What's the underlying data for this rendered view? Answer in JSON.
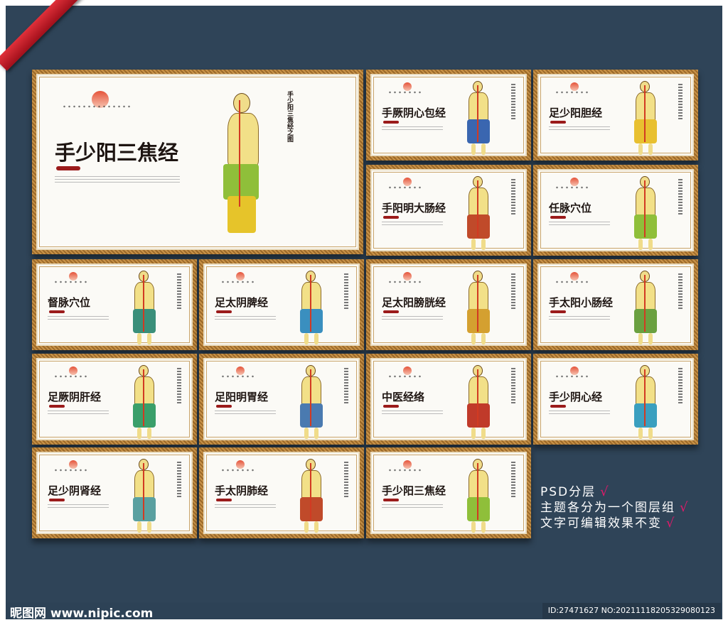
{
  "main_poster": {
    "title": "手少阳三焦经",
    "side_title": "手少阳三焦经之图"
  },
  "posters": [
    {
      "title": "手厥阴心包经"
    },
    {
      "title": "足少阳胆经"
    },
    {
      "title": "手阳明大肠经"
    },
    {
      "title": "任脉穴位"
    },
    {
      "title": "督脉穴位"
    },
    {
      "title": "足太阴脾经"
    },
    {
      "title": "足太阳膀胱经"
    },
    {
      "title": "手太阳小肠经"
    },
    {
      "title": "足厥阴肝经"
    },
    {
      "title": "足阳明胃经"
    },
    {
      "title": "中医经络"
    },
    {
      "title": "手少阴心经"
    },
    {
      "title": "足少阴肾经"
    },
    {
      "title": "手太阴肺经"
    },
    {
      "title": "手少阳三焦经"
    }
  ],
  "features": [
    "PSD分层",
    "主题各分为一个图层组",
    "文字可编辑效果不变"
  ],
  "check_mark": "√",
  "footer": {
    "logo": "昵图网 www.nipic.com",
    "id": "ID:27471627 NO:20211118205329080123"
  },
  "colors": {
    "background": "#2f4458",
    "frame": "#b07a33",
    "check": "#e01a6a"
  }
}
